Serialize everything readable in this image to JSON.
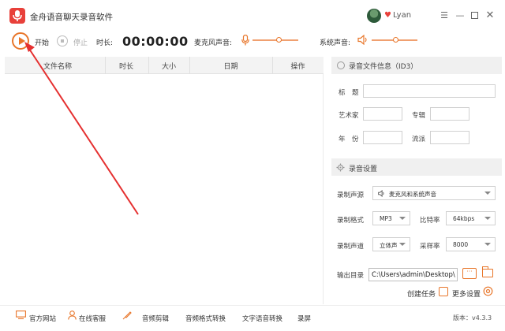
{
  "app": {
    "title": "金舟语音聊天录音软件",
    "username": "Lyan"
  },
  "window_controls": [
    "menu-icon",
    "minimize-icon",
    "maximize-icon",
    "close-icon"
  ],
  "toolbar": {
    "start_label": "开始",
    "stop_label": "停止",
    "duration_label": "时长:",
    "duration_value": "00:00:00",
    "mic_label": "麦克风声音:",
    "system_label": "系统声音:",
    "mic_level": 0.57,
    "system_level": 0.52
  },
  "table": {
    "headers": [
      "文件名称",
      "时长",
      "大小",
      "日期",
      "操作"
    ],
    "rows": []
  },
  "id3": {
    "title": "录音文件信息（ID3）",
    "labels": {
      "title": "标　题",
      "artist": "艺术家",
      "album": "专辑",
      "year": "年　份",
      "genre": "流派"
    }
  },
  "settings": {
    "title": "录音设置",
    "source_label": "录制声源",
    "source_value": "麦克风和系统声音",
    "format_label": "录制格式",
    "format_value": "MP3",
    "bitrate_label": "比特率",
    "bitrate_value": "64kbps",
    "channel_label": "录制声道",
    "channel_value": "立体声",
    "samplerate_label": "采样率",
    "samplerate_value": "8000",
    "output_label": "输出目录",
    "output_value": "C:\\Users\\admin\\Desktop\\",
    "browse_label": "···",
    "create_task_label": "创建任务",
    "more_settings_label": "更多设置"
  },
  "footer": {
    "items": [
      "官方网站",
      "在线客服",
      "音频剪辑",
      "音频格式转换",
      "文字语音转换",
      "录屏"
    ],
    "version": "版本：v4.3.3"
  },
  "colors": {
    "accent": "#e8762a",
    "brand": "#e8403a",
    "arrow": "#e53030"
  }
}
